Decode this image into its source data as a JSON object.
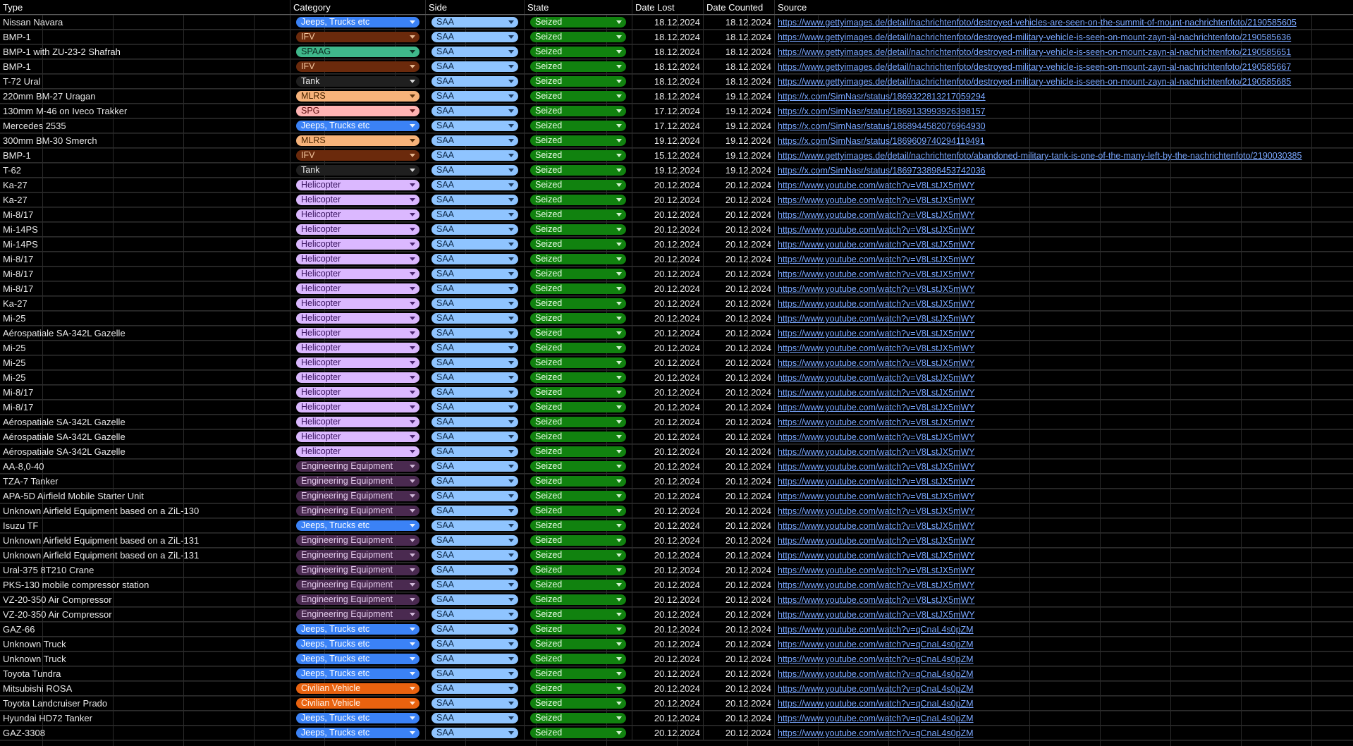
{
  "columns": [
    "Type",
    "Category",
    "Side",
    "State",
    "Date Lost",
    "Date Counted",
    "Source"
  ],
  "category_styles": {
    "Jeeps, Trucks etc": {
      "bg": "#3b82f6",
      "fg": "#ffffff"
    },
    "IFV": {
      "bg": "#6b2a0c",
      "fg": "#f4c8a0"
    },
    "SPAAG": {
      "bg": "#3fb88b",
      "fg": "#0b2a20"
    },
    "Tank": {
      "bg": "#1f1f1f",
      "fg": "#e8e8e8"
    },
    "MLRS": {
      "bg": "#f7b37a",
      "fg": "#4a2500"
    },
    "SPG": {
      "bg": "#ffb3b3",
      "fg": "#5a0d0d"
    },
    "Helicopter": {
      "bg": "#dbb8ff",
      "fg": "#3a1560"
    },
    "Engineering Equipment": {
      "bg": "#4a2a50",
      "fg": "#e0c8e8"
    },
    "Civilian Vehicle": {
      "bg": "#e8620f",
      "fg": "#fff2e6"
    }
  },
  "rows": [
    {
      "type": "Nissan Navara",
      "category": "Jeeps, Trucks etc",
      "side": "SAA",
      "state": "Seized",
      "date_lost": "18.12.2024",
      "date_counted": "18.12.2024",
      "source": "https://www.gettyimages.de/detail/nachrichtenfoto/destroyed-vehicles-are-seen-on-the-summit-of-mount-nachrichtenfoto/2190585605"
    },
    {
      "type": "BMP-1",
      "category": "IFV",
      "side": "SAA",
      "state": "Seized",
      "date_lost": "18.12.2024",
      "date_counted": "18.12.2024",
      "source": "https://www.gettyimages.de/detail/nachrichtenfoto/destroyed-military-vehicle-is-seen-on-mount-zayn-al-nachrichtenfoto/2190585636"
    },
    {
      "type": "BMP-1 with ZU-23-2 Shafrah",
      "category": "SPAAG",
      "side": "SAA",
      "state": "Seized",
      "date_lost": "18.12.2024",
      "date_counted": "18.12.2024",
      "source": "https://www.gettyimages.de/detail/nachrichtenfoto/destroyed-military-vehicle-is-seen-on-mount-zayn-al-nachrichtenfoto/2190585651"
    },
    {
      "type": "BMP-1",
      "category": "IFV",
      "side": "SAA",
      "state": "Seized",
      "date_lost": "18.12.2024",
      "date_counted": "18.12.2024",
      "source": "https://www.gettyimages.de/detail/nachrichtenfoto/destroyed-military-vehicle-is-seen-on-mount-zayn-al-nachrichtenfoto/2190585667"
    },
    {
      "type": "T-72 Ural",
      "category": "Tank",
      "side": "SAA",
      "state": "Seized",
      "date_lost": "18.12.2024",
      "date_counted": "18.12.2024",
      "source": "https://www.gettyimages.de/detail/nachrichtenfoto/destroyed-military-vehicle-is-seen-on-mount-zayn-al-nachrichtenfoto/2190585685"
    },
    {
      "type": "220mm BM-27 Uragan",
      "category": "MLRS",
      "side": "SAA",
      "state": "Seized",
      "date_lost": "18.12.2024",
      "date_counted": "19.12.2024",
      "source": "https://x.com/SimNasr/status/1869322813217059294"
    },
    {
      "type": "130mm M-46 on Iveco Trakker",
      "category": "SPG",
      "side": "SAA",
      "state": "Seized",
      "date_lost": "17.12.2024",
      "date_counted": "19.12.2024",
      "source": "https://x.com/SimNasr/status/1869133993926398157"
    },
    {
      "type": "Mercedes 2535",
      "category": "Jeeps, Trucks etc",
      "side": "SAA",
      "state": "Seized",
      "date_lost": "17.12.2024",
      "date_counted": "19.12.2024",
      "source": "https://x.com/SimNasr/status/1868944582076964930"
    },
    {
      "type": "300mm BM-30 Smerch",
      "category": "MLRS",
      "side": "SAA",
      "state": "Seized",
      "date_lost": "19.12.2024",
      "date_counted": "19.12.2024",
      "source": "https://x.com/SimNasr/status/1869609740294119491"
    },
    {
      "type": "BMP-1",
      "category": "IFV",
      "side": "SAA",
      "state": "Seized",
      "date_lost": "15.12.2024",
      "date_counted": "19.12.2024",
      "source": "https://www.gettyimages.de/detail/nachrichtenfoto/abandoned-military-tank-is-one-of-the-many-left-by-the-nachrichtenfoto/2190030385"
    },
    {
      "type": "T-62",
      "category": "Tank",
      "side": "SAA",
      "state": "Seized",
      "date_lost": "19.12.2024",
      "date_counted": "19.12.2024",
      "source": "https://x.com/SimNasr/status/1869733898453742036"
    },
    {
      "type": "Ka-27",
      "category": "Helicopter",
      "side": "SAA",
      "state": "Seized",
      "date_lost": "20.12.2024",
      "date_counted": "20.12.2024",
      "source": "https://www.youtube.com/watch?v=V8LstJX5mWY"
    },
    {
      "type": "Ka-27",
      "category": "Helicopter",
      "side": "SAA",
      "state": "Seized",
      "date_lost": "20.12.2024",
      "date_counted": "20.12.2024",
      "source": "https://www.youtube.com/watch?v=V8LstJX5mWY"
    },
    {
      "type": "Mi-8/17",
      "category": "Helicopter",
      "side": "SAA",
      "state": "Seized",
      "date_lost": "20.12.2024",
      "date_counted": "20.12.2024",
      "source": "https://www.youtube.com/watch?v=V8LstJX5mWY"
    },
    {
      "type": "Mi-14PS",
      "category": "Helicopter",
      "side": "SAA",
      "state": "Seized",
      "date_lost": "20.12.2024",
      "date_counted": "20.12.2024",
      "source": "https://www.youtube.com/watch?v=V8LstJX5mWY"
    },
    {
      "type": "Mi-14PS",
      "category": "Helicopter",
      "side": "SAA",
      "state": "Seized",
      "date_lost": "20.12.2024",
      "date_counted": "20.12.2024",
      "source": "https://www.youtube.com/watch?v=V8LstJX5mWY"
    },
    {
      "type": "Mi-8/17",
      "category": "Helicopter",
      "side": "SAA",
      "state": "Seized",
      "date_lost": "20.12.2024",
      "date_counted": "20.12.2024",
      "source": "https://www.youtube.com/watch?v=V8LstJX5mWY"
    },
    {
      "type": "Mi-8/17",
      "category": "Helicopter",
      "side": "SAA",
      "state": "Seized",
      "date_lost": "20.12.2024",
      "date_counted": "20.12.2024",
      "source": "https://www.youtube.com/watch?v=V8LstJX5mWY"
    },
    {
      "type": "Mi-8/17",
      "category": "Helicopter",
      "side": "SAA",
      "state": "Seized",
      "date_lost": "20.12.2024",
      "date_counted": "20.12.2024",
      "source": "https://www.youtube.com/watch?v=V8LstJX5mWY"
    },
    {
      "type": "Ka-27",
      "category": "Helicopter",
      "side": "SAA",
      "state": "Seized",
      "date_lost": "20.12.2024",
      "date_counted": "20.12.2024",
      "source": "https://www.youtube.com/watch?v=V8LstJX5mWY"
    },
    {
      "type": "Mi-25",
      "category": "Helicopter",
      "side": "SAA",
      "state": "Seized",
      "date_lost": "20.12.2024",
      "date_counted": "20.12.2024",
      "source": "https://www.youtube.com/watch?v=V8LstJX5mWY"
    },
    {
      "type": "Aérospatiale SA-342L Gazelle",
      "category": "Helicopter",
      "side": "SAA",
      "state": "Seized",
      "date_lost": "20.12.2024",
      "date_counted": "20.12.2024",
      "source": "https://www.youtube.com/watch?v=V8LstJX5mWY"
    },
    {
      "type": "Mi-25",
      "category": "Helicopter",
      "side": "SAA",
      "state": "Seized",
      "date_lost": "20.12.2024",
      "date_counted": "20.12.2024",
      "source": "https://www.youtube.com/watch?v=V8LstJX5mWY"
    },
    {
      "type": "Mi-25",
      "category": "Helicopter",
      "side": "SAA",
      "state": "Seized",
      "date_lost": "20.12.2024",
      "date_counted": "20.12.2024",
      "source": "https://www.youtube.com/watch?v=V8LstJX5mWY"
    },
    {
      "type": "Mi-25",
      "category": "Helicopter",
      "side": "SAA",
      "state": "Seized",
      "date_lost": "20.12.2024",
      "date_counted": "20.12.2024",
      "source": "https://www.youtube.com/watch?v=V8LstJX5mWY"
    },
    {
      "type": "Mi-8/17",
      "category": "Helicopter",
      "side": "SAA",
      "state": "Seized",
      "date_lost": "20.12.2024",
      "date_counted": "20.12.2024",
      "source": "https://www.youtube.com/watch?v=V8LstJX5mWY"
    },
    {
      "type": "Mi-8/17",
      "category": "Helicopter",
      "side": "SAA",
      "state": "Seized",
      "date_lost": "20.12.2024",
      "date_counted": "20.12.2024",
      "source": "https://www.youtube.com/watch?v=V8LstJX5mWY"
    },
    {
      "type": "Aérospatiale SA-342L Gazelle",
      "category": "Helicopter",
      "side": "SAA",
      "state": "Seized",
      "date_lost": "20.12.2024",
      "date_counted": "20.12.2024",
      "source": "https://www.youtube.com/watch?v=V8LstJX5mWY"
    },
    {
      "type": "Aérospatiale SA-342L Gazelle",
      "category": "Helicopter",
      "side": "SAA",
      "state": "Seized",
      "date_lost": "20.12.2024",
      "date_counted": "20.12.2024",
      "source": "https://www.youtube.com/watch?v=V8LstJX5mWY"
    },
    {
      "type": "Aérospatiale SA-342L Gazelle",
      "category": "Helicopter",
      "side": "SAA",
      "state": "Seized",
      "date_lost": "20.12.2024",
      "date_counted": "20.12.2024",
      "source": "https://www.youtube.com/watch?v=V8LstJX5mWY"
    },
    {
      "type": "AA-8,0-40",
      "category": "Engineering Equipment",
      "side": "SAA",
      "state": "Seized",
      "date_lost": "20.12.2024",
      "date_counted": "20.12.2024",
      "source": "https://www.youtube.com/watch?v=V8LstJX5mWY"
    },
    {
      "type": "TZA-7 Tanker",
      "category": "Engineering Equipment",
      "side": "SAA",
      "state": "Seized",
      "date_lost": "20.12.2024",
      "date_counted": "20.12.2024",
      "source": "https://www.youtube.com/watch?v=V8LstJX5mWY"
    },
    {
      "type": "APA-5D Airfield Mobile Starter Unit",
      "category": "Engineering Equipment",
      "side": "SAA",
      "state": "Seized",
      "date_lost": "20.12.2024",
      "date_counted": "20.12.2024",
      "source": "https://www.youtube.com/watch?v=V8LstJX5mWY"
    },
    {
      "type": "Unknown Airfield Equipment based on a ZiL-130",
      "category": "Engineering Equipment",
      "side": "SAA",
      "state": "Seized",
      "date_lost": "20.12.2024",
      "date_counted": "20.12.2024",
      "source": "https://www.youtube.com/watch?v=V8LstJX5mWY"
    },
    {
      "type": "Isuzu TF",
      "category": "Jeeps, Trucks etc",
      "side": "SAA",
      "state": "Seized",
      "date_lost": "20.12.2024",
      "date_counted": "20.12.2024",
      "source": "https://www.youtube.com/watch?v=V8LstJX5mWY"
    },
    {
      "type": "Unknown Airfield Equipment based on a ZiL-131",
      "category": "Engineering Equipment",
      "side": "SAA",
      "state": "Seized",
      "date_lost": "20.12.2024",
      "date_counted": "20.12.2024",
      "source": "https://www.youtube.com/watch?v=V8LstJX5mWY"
    },
    {
      "type": "Unknown Airfield Equipment based on a ZiL-131",
      "category": "Engineering Equipment",
      "side": "SAA",
      "state": "Seized",
      "date_lost": "20.12.2024",
      "date_counted": "20.12.2024",
      "source": "https://www.youtube.com/watch?v=V8LstJX5mWY"
    },
    {
      "type": "Ural-375 8T210 Crane",
      "category": "Engineering Equipment",
      "side": "SAA",
      "state": "Seized",
      "date_lost": "20.12.2024",
      "date_counted": "20.12.2024",
      "source": "https://www.youtube.com/watch?v=V8LstJX5mWY"
    },
    {
      "type": "PKS-130 mobile compressor station",
      "category": "Engineering Equipment",
      "side": "SAA",
      "state": "Seized",
      "date_lost": "20.12.2024",
      "date_counted": "20.12.2024",
      "source": "https://www.youtube.com/watch?v=V8LstJX5mWY"
    },
    {
      "type": "VZ-20-350 Air Compressor",
      "category": "Engineering Equipment",
      "side": "SAA",
      "state": "Seized",
      "date_lost": "20.12.2024",
      "date_counted": "20.12.2024",
      "source": "https://www.youtube.com/watch?v=V8LstJX5mWY"
    },
    {
      "type": "VZ-20-350 Air Compressor",
      "category": "Engineering Equipment",
      "side": "SAA",
      "state": "Seized",
      "date_lost": "20.12.2024",
      "date_counted": "20.12.2024",
      "source": "https://www.youtube.com/watch?v=V8LstJX5mWY"
    },
    {
      "type": "GAZ-66",
      "category": "Jeeps, Trucks etc",
      "side": "SAA",
      "state": "Seized",
      "date_lost": "20.12.2024",
      "date_counted": "20.12.2024",
      "source": "https://www.youtube.com/watch?v=qCnaL4s0pZM"
    },
    {
      "type": "Unknown Truck",
      "category": "Jeeps, Trucks etc",
      "side": "SAA",
      "state": "Seized",
      "date_lost": "20.12.2024",
      "date_counted": "20.12.2024",
      "source": "https://www.youtube.com/watch?v=qCnaL4s0pZM"
    },
    {
      "type": "Unknown Truck",
      "category": "Jeeps, Trucks etc",
      "side": "SAA",
      "state": "Seized",
      "date_lost": "20.12.2024",
      "date_counted": "20.12.2024",
      "source": "https://www.youtube.com/watch?v=qCnaL4s0pZM"
    },
    {
      "type": "Toyota Tundra",
      "category": "Jeeps, Trucks etc",
      "side": "SAA",
      "state": "Seized",
      "date_lost": "20.12.2024",
      "date_counted": "20.12.2024",
      "source": "https://www.youtube.com/watch?v=qCnaL4s0pZM"
    },
    {
      "type": "Mitsubishi ROSA",
      "category": "Civilian Vehicle",
      "side": "SAA",
      "state": "Seized",
      "date_lost": "20.12.2024",
      "date_counted": "20.12.2024",
      "source": "https://www.youtube.com/watch?v=qCnaL4s0pZM"
    },
    {
      "type": "Toyota Landcruiser Prado",
      "category": "Civilian Vehicle",
      "side": "SAA",
      "state": "Seized",
      "date_lost": "20.12.2024",
      "date_counted": "20.12.2024",
      "source": "https://www.youtube.com/watch?v=qCnaL4s0pZM"
    },
    {
      "type": "Hyundai HD72 Tanker",
      "category": "Jeeps, Trucks etc",
      "side": "SAA",
      "state": "Seized",
      "date_lost": "20.12.2024",
      "date_counted": "20.12.2024",
      "source": "https://www.youtube.com/watch?v=qCnaL4s0pZM"
    },
    {
      "type": "GAZ-3308",
      "category": "Jeeps, Trucks etc",
      "side": "SAA",
      "state": "Seized",
      "date_lost": "20.12.2024",
      "date_counted": "20.12.2024",
      "source": "https://www.youtube.com/watch?v=qCnaL4s0pZM"
    }
  ]
}
